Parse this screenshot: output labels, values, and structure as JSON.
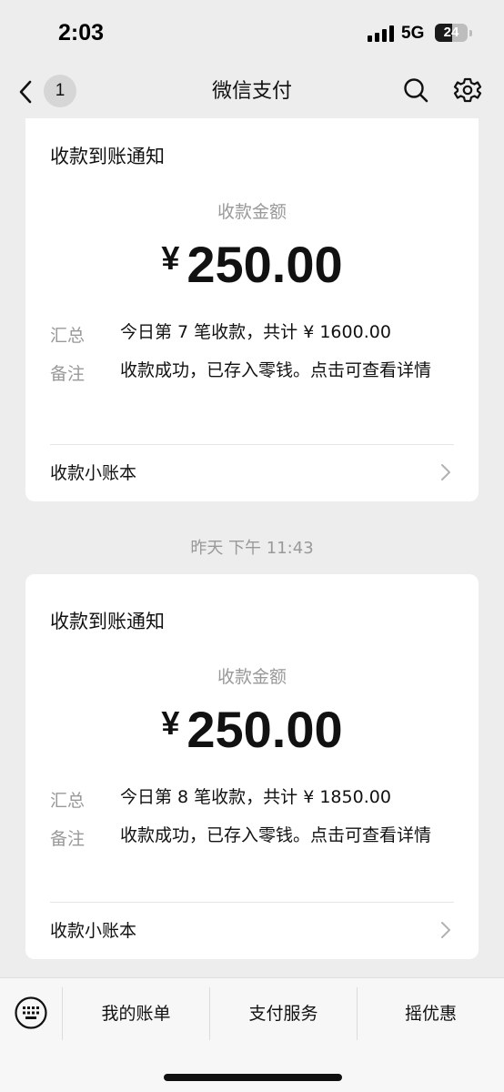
{
  "status_bar": {
    "time": "2:03",
    "network": "5G",
    "battery": "24",
    "battery_level": 0.24
  },
  "nav": {
    "back_count": "1",
    "title": "微信支付",
    "icons": [
      "back-chevron-icon",
      "search-icon",
      "settings-icon"
    ]
  },
  "messages": [
    {
      "title": "收款到账通知",
      "amount_label": "收款金额",
      "currency": "¥",
      "amount": "250.00",
      "summary_label": "汇总",
      "summary_value": "今日第 7 笔收款，共计 ¥ 1600.00",
      "note_label": "备注",
      "note_value": "收款成功，已存入零钱。点击可查看详情",
      "link_label": "收款小账本"
    },
    {
      "timestamp": "昨天 下午 11:43",
      "title": "收款到账通知",
      "amount_label": "收款金额",
      "currency": "¥",
      "amount": "250.00",
      "summary_label": "汇总",
      "summary_value": "今日第 8 笔收款，共计 ¥ 1850.00",
      "note_label": "备注",
      "note_value": "收款成功，已存入零钱。点击可查看详情",
      "link_label": "收款小账本"
    }
  ],
  "bottom_menu": {
    "keyboard_icon": "keyboard-icon",
    "items": [
      "我的账单",
      "支付服务",
      "摇优惠"
    ]
  },
  "colors": {
    "background": "#ededed",
    "card": "#ffffff",
    "muted_text": "#999999",
    "primary_text": "#111111"
  }
}
